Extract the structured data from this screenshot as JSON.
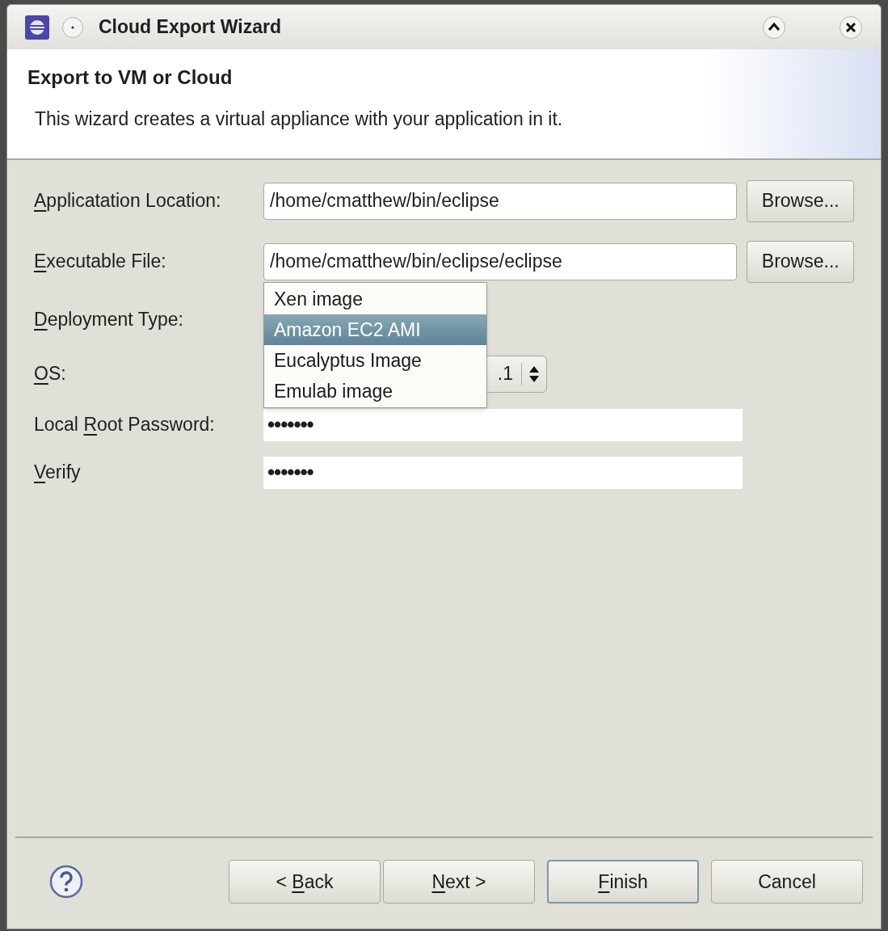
{
  "window": {
    "title": "Cloud Export Wizard"
  },
  "header": {
    "title": "Export to VM or Cloud",
    "description": "This wizard creates a virtual appliance with your application in it."
  },
  "form": {
    "rows": [
      {
        "kind": "text",
        "label": {
          "key": "A",
          "after": "pplicatation Location:"
        },
        "value": "/home/cmatthew/bin/eclipse",
        "button": "Browse..."
      },
      {
        "kind": "text",
        "label": {
          "key": "E",
          "after": "xecutable File:"
        },
        "value": "/home/cmatthew/bin/eclipse/eclipse",
        "button": "Browse..."
      },
      {
        "kind": "open_combo",
        "label": {
          "key": "D",
          "after": "eployment Type:"
        },
        "options": [
          {
            "label": "Xen image",
            "selected": false
          },
          {
            "label": "Amazon EC2 AMI",
            "selected": true
          },
          {
            "label": "Eucalyptus Image",
            "selected": false
          },
          {
            "label": "Emulab image",
            "selected": false
          }
        ]
      },
      {
        "kind": "combo",
        "label": {
          "key": "O",
          "after": "S:"
        },
        "value": ".1"
      },
      {
        "kind": "password",
        "label": {
          "before": "Local ",
          "key": "R",
          "after": "oot Password:"
        },
        "value": "•••••••"
      },
      {
        "kind": "password",
        "label": {
          "key": "V",
          "after": "erify"
        },
        "value": "•••••••"
      }
    ]
  },
  "buttons": [
    {
      "label": {
        "before": "< ",
        "key": "B",
        "after": "ack"
      },
      "default": false
    },
    {
      "label": {
        "key": "N",
        "after": "ext >"
      },
      "default": false
    },
    {
      "label": {
        "key": "F",
        "after": "inish"
      },
      "default": true
    },
    {
      "label": {
        "before": "Cancel"
      },
      "default": false
    }
  ]
}
